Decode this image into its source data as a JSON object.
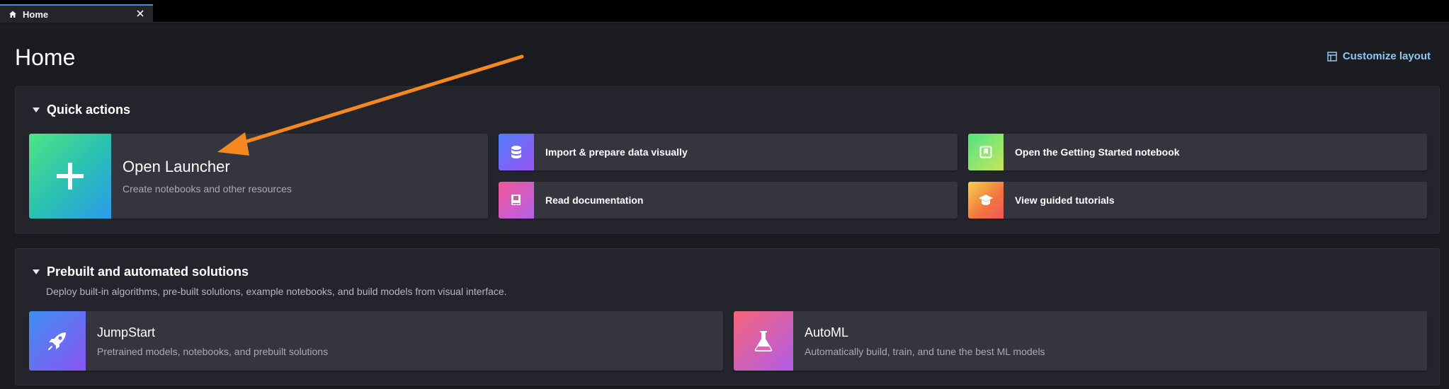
{
  "tab": {
    "label": "Home",
    "icon": "home-icon",
    "close_icon": "close-icon"
  },
  "page": {
    "title": "Home",
    "customize_label": "Customize layout",
    "customize_icon": "layout-icon"
  },
  "quick_actions": {
    "heading": "Quick actions",
    "launcher": {
      "title": "Open Launcher",
      "subtitle": "Create notebooks and other resources",
      "icon": "plus-icon"
    },
    "items": [
      {
        "label": "Import & prepare data visually",
        "icon": "database-icon"
      },
      {
        "label": "Open the Getting Started notebook",
        "icon": "notebook-icon"
      },
      {
        "label": "Read documentation",
        "icon": "book-icon"
      },
      {
        "label": "View guided tutorials",
        "icon": "graduation-cap-icon"
      }
    ]
  },
  "prebuilt": {
    "heading": "Prebuilt and automated solutions",
    "description": "Deploy built-in algorithms, pre-built solutions, example notebooks, and build models from visual interface.",
    "cards": [
      {
        "title": "JumpStart",
        "subtitle": "Pretrained models, notebooks, and prebuilt solutions",
        "icon": "rocket-icon"
      },
      {
        "title": "AutoML",
        "subtitle": "Automatically build, train, and tune the best ML models",
        "icon": "flask-icon"
      }
    ]
  },
  "annotation": {
    "arrow_color": "#f5891f",
    "icon": "annotation-arrow-icon"
  }
}
